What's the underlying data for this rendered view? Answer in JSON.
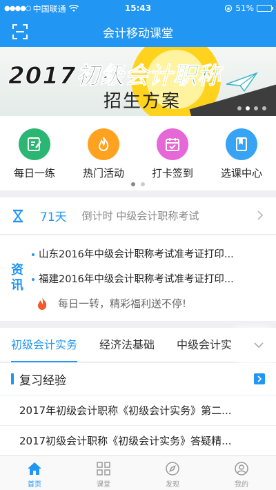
{
  "status": {
    "signal": "●●●●○",
    "carrier": "中国联通",
    "time": "15:43",
    "battery": "51%",
    "battery_level": 0.51
  },
  "nav": {
    "title": "会计移动课堂",
    "scan_icon": "scan-icon"
  },
  "banner": {
    "year": "2017",
    "headline_a": "初级",
    "headline_b": "会计",
    "headline_c": "职称",
    "subtitle": "招生方案",
    "slides": 4,
    "active_slide": 2
  },
  "quick": [
    {
      "label": "每日一练",
      "icon": "edit-icon",
      "color": "#2bb673"
    },
    {
      "label": "热门活动",
      "icon": "flame-icon",
      "color": "#ffa21f"
    },
    {
      "label": "打卡签到",
      "icon": "calendar-check-icon",
      "color": "#e667d6"
    },
    {
      "label": "选课中心",
      "icon": "book-icon",
      "color": "#36a3f4"
    }
  ],
  "countdown": {
    "days": "71天",
    "text": "倒计时 中级会计职称考试"
  },
  "news": {
    "tag": "资讯",
    "items": [
      "山东2016年中级会计职称考试准考证打印...",
      "福建2016年中级会计职称考试准考证打印..."
    ],
    "promo": "每日一转，精彩福利送不停!"
  },
  "tabs": [
    "初级会计实务",
    "经济法基础",
    "中级会计实"
  ],
  "section": {
    "title": "复习经验",
    "articles": [
      "2017年初级会计职称《初级会计实务》第二...",
      "2017初级会计职称《初级会计实务》答疑精..."
    ]
  },
  "tabbar": [
    "首页",
    "课堂",
    "发现",
    "我的"
  ],
  "colors": {
    "accent": "#2196f3"
  }
}
